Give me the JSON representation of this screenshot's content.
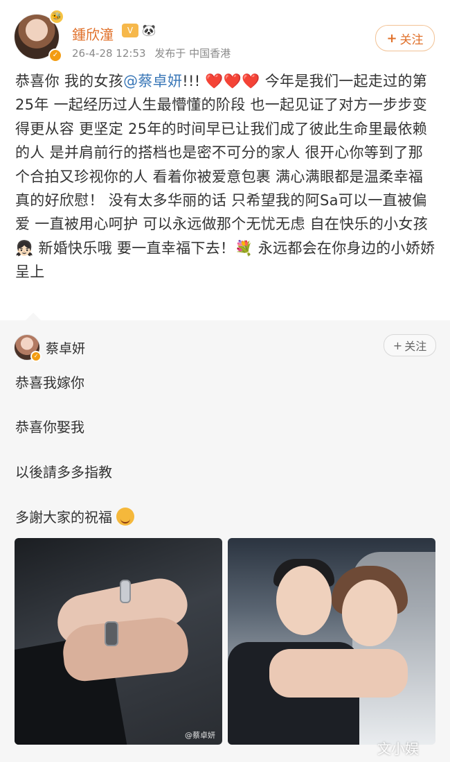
{
  "post": {
    "author": {
      "name": "鍾欣潼",
      "badge_vip": "V",
      "badge_panda": "🐼",
      "avatar_badge": "🐝"
    },
    "meta": {
      "timestamp": "26-4-28 12:53",
      "location": "发布于 中国香港"
    },
    "follow_label": "关注",
    "follow_plus": "+",
    "content": {
      "part1": "恭喜你 我的女孩",
      "mention": "@蔡卓妍",
      "part2": "!!! ",
      "hearts": "❤️❤️❤️",
      "part3": " 今年是我们一起走过的第25年 一起经历过人生最懵懂的阶段 也一起见证了对方一步步变得更从容 更坚定  25年的时间早已让我们成了彼此生命里最依赖的人 是并肩前行的搭档也是密不可分的家人  很开心你等到了那个合拍又珍视你的人 看着你被爱意包裹 满心满眼都是温柔幸福 真的好欣慰！  没有太多华丽的话 只希望我的阿Sa可以一直被偏爱 一直被用心呵护  可以永远做那个无忧无虑 自在快乐的小女孩👧🏻  新婚快乐哦 要一直幸福下去！💐                 永远都会在你身边的小娇娇 呈上"
    }
  },
  "repost": {
    "author": {
      "name": "蔡卓妍"
    },
    "follow_label": "关注",
    "follow_plus": "+",
    "lines": [
      "恭喜我嫁你",
      "恭喜你娶我",
      "以後請多多指教",
      "多謝大家的祝福"
    ],
    "photo_watermark": "@蔡卓妍"
  },
  "watermark": "文小娱",
  "colors": {
    "accent": "#e0702a",
    "mention": "#3b78b8",
    "repost_bg": "#f6f6f6"
  },
  "icons": [
    "verified-badge-icon",
    "plus-icon",
    "heart-icon",
    "smiling-face-icon"
  ]
}
